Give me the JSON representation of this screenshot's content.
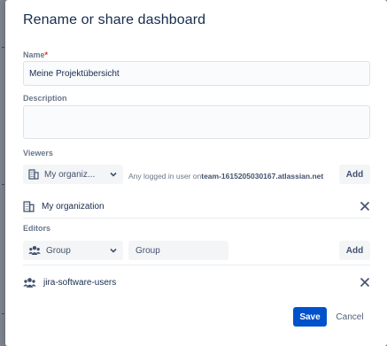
{
  "dialog": {
    "title": "Rename or share dashboard"
  },
  "name_field": {
    "label": "Name",
    "required_marker": "*",
    "value": "Meine Projektübersicht"
  },
  "description_field": {
    "label": "Description",
    "value": ""
  },
  "viewers": {
    "label": "Viewers",
    "selector_value": "My organiz...",
    "helper_prefix": "Any logged in user on",
    "helper_site": "team-1615205030167.atlassian.net",
    "add_label": "Add",
    "entries": [
      {
        "name": "My organization",
        "icon": "building-icon"
      }
    ]
  },
  "editors": {
    "label": "Editors",
    "type_selector_value": "Group",
    "group_selector_placeholder": "Group",
    "add_label": "Add",
    "entries": [
      {
        "name": "jira-software-users",
        "icon": "people-icon"
      }
    ]
  },
  "footer": {
    "save_label": "Save",
    "cancel_label": "Cancel"
  },
  "colors": {
    "primary": "#0052cc",
    "text": "#172b4d",
    "subtle": "#6b778c"
  }
}
